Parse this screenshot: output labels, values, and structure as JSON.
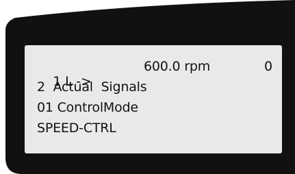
{
  "display": {
    "row1": {
      "control_location": "1 L ->",
      "reference_speed": "600.0 rpm",
      "status_code": "0"
    },
    "row2": {
      "parameter_group": "2  Actual  Signals"
    },
    "row3": {
      "parameter_name": "01 ControlMode"
    },
    "row4": {
      "parameter_value": "SPEED-CTRL"
    }
  },
  "colors": {
    "bezel": "#111111",
    "screen_background": "#e9e9e9",
    "text": "#111111"
  }
}
